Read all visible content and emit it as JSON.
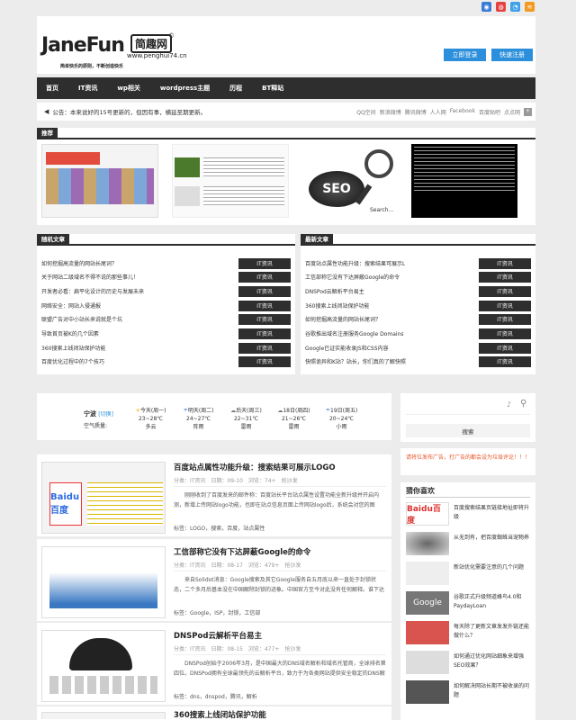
{
  "social_icons": [
    "qq-icon",
    "weibo-icon",
    "tencent-icon",
    "rss-icon"
  ],
  "header": {
    "logo_en": "JaneFun",
    "logo_cn": "简趣网",
    "logo_mark": "©",
    "url": "www.penghui74.cn",
    "slogan": "简单快乐的原则，不断创造快乐",
    "login": "立即登录",
    "register": "快速注册"
  },
  "nav": [
    "首页",
    "IT资讯",
    "wp相关",
    "wordpress主题",
    "历程",
    "BT释站"
  ],
  "notice": {
    "text": "公告：本来说好的15号更新的，但因有事，横延至期更新。",
    "shares": [
      "QQ空间",
      "新浪微博",
      "腾讯微博",
      "人人网",
      "Facebook",
      "百度贴吧",
      "点点网"
    ]
  },
  "featured": {
    "title": "推荐",
    "caption": "Search..."
  },
  "random": {
    "title": "随机文章",
    "cat": "IT资讯",
    "items": [
      "如何挖掘高流量的网站长尾词？",
      "关于网站二级域名不得不说的那些事儿！",
      "开发者必看：扁平化设计的历史与发展未来",
      "网络安全：网站入侵通报",
      "联盟广告对中小站长来说就是个坑",
      "导致首页被K的几个因素",
      "360搜索上线闭站保护功能",
      "百度优化过程中的7个技巧"
    ]
  },
  "latest": {
    "title": "最新文章",
    "cat": "IT资讯",
    "items": [
      "百度站点属性功能升级：搜索结果可展示L",
      "工信部称它没有下达屏蔽Google的命令",
      "DNSPod云解析平台易主",
      "360搜索上线闭站保护功能",
      "如何挖掘高流量的网站长尾词？",
      "谷歌推出域名注册服务Google Domains",
      "Google已证实能收录JS和CSS内容",
      "快照诡异和K站？站长，你们真的了解快照"
    ]
  },
  "weather": {
    "city": "宁波",
    "city_link": "[切换]",
    "aq_label": "空气质量:",
    "days": [
      {
        "label": "今天(周一)",
        "temp": "23~28℃",
        "desc": "多云"
      },
      {
        "label": "明天(周二)",
        "temp": "24~27℃",
        "desc": "阵雨"
      },
      {
        "label": "后天(周三)",
        "temp": "22~31℃",
        "desc": "雷雨"
      },
      {
        "label": "18日(周四)",
        "temp": "21~26℃",
        "desc": "雷雨"
      },
      {
        "label": "19日(周五)",
        "temp": "20~24℃",
        "desc": "小雨"
      }
    ]
  },
  "search": {
    "button": "搜索"
  },
  "ad_notice": "请将位发布广告，打广告的都会设为垃圾评论！！！",
  "guess": {
    "title": "猜你喜欢",
    "items": [
      "百度搜索结果页链接地址即将升级",
      "从无到有，把百度蜘蛛当宠物养",
      "新站优化需要注意的几个问题",
      "谷歌正式升级频道蜂鸟4.0和PaydayLoan",
      "每天除了更新文章发发外链还能做什么？",
      "如何通过优化网站细象来增强SEO效果？",
      "如何解决网站长期不被收录的问题"
    ]
  },
  "posts": [
    {
      "title": "百度站点属性功能升级：搜索结果可展示LOGO",
      "category": "分类：IT资讯",
      "date": "日期：09-10",
      "views": "浏览：74+",
      "comments": "抢沙发",
      "excerpt": "刚刚收到了百度发来的邮件称：百度站长平台站点属性设置功能全新升级并开启内测，新增上传网站logo功能，也即在站点信息页面上传网站logo后，系统会对您的图",
      "tags": "标签：LOGO，搜索，百度，站点属性"
    },
    {
      "title": "工信部称它没有下达屏蔽Google的命令",
      "category": "分类：IT资讯",
      "date": "日期：08-17",
      "views": "浏览：479+",
      "comments": "抢沙发",
      "excerpt": "来自Solidot消息：Google搜索及其它Google服务自五月底以来一直处于封锁状态，二个多月后基本没在中国解除封锁的迹象。中国官方至今对此没有任何解释。谁下达",
      "tags": "标签：Google，ISP，封锁，工信部"
    },
    {
      "title": "DNSPod云解析平台易主",
      "category": "分类：IT资讯",
      "date": "日期：08-15",
      "views": "浏览：477+",
      "comments": "抢沙发",
      "excerpt": "DNSPod创始于2006年3月，是中国最大的DNS域名解析和域名托管商，全球排名第四位。DNSPod拥有全球最领先的云解析平台，致力于为各类网站提供安全稳定的DNS解",
      "tags": "标签：dns，dnspod，腾讯，解析"
    },
    {
      "title": "360搜索上线闭站保护功能",
      "category": "",
      "date": "",
      "views": "",
      "comments": "",
      "excerpt": "",
      "tags": ""
    }
  ],
  "thumb_texts": {
    "baidu": "Baidu百度",
    "seo": "SEO",
    "google": "Google"
  }
}
